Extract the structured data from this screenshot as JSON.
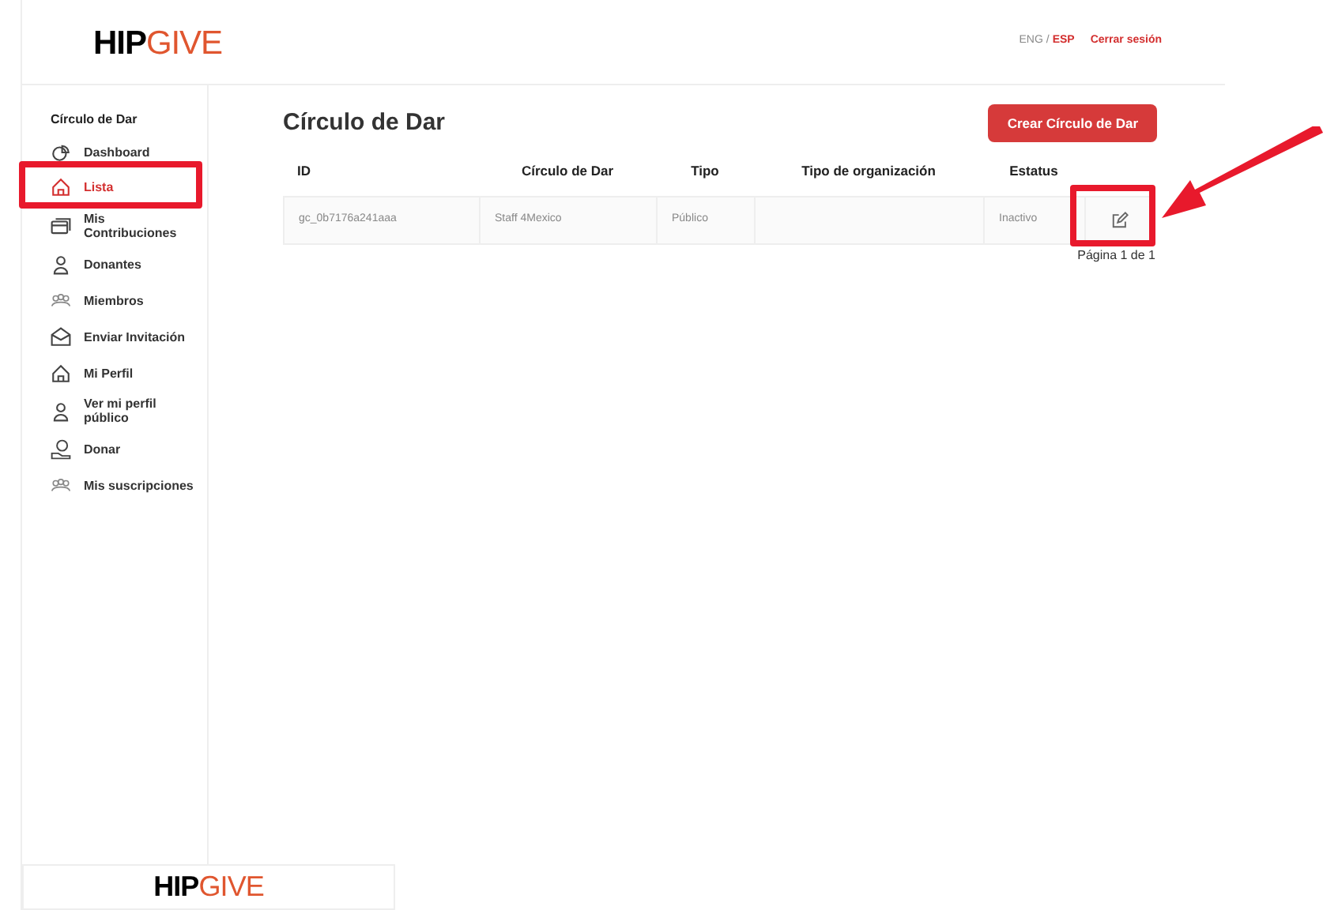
{
  "header": {
    "logo": {
      "bold": "HIP",
      "light": "GIVE"
    },
    "languages": [
      {
        "label": "ENG",
        "selected": false
      },
      {
        "label": "ESP",
        "selected": true
      }
    ],
    "separator": "/",
    "logout": "Cerrar sesión"
  },
  "sidebar": {
    "title": "Círculo de Dar",
    "items": [
      {
        "label": "Dashboard",
        "selected": false
      },
      {
        "label": "Lista",
        "selected": true
      },
      {
        "label": "Mis Contribuciones",
        "selected": false
      },
      {
        "label": "Donantes",
        "selected": false
      },
      {
        "label": "Miembros",
        "selected": false
      },
      {
        "label": "Enviar Invitación",
        "selected": false
      },
      {
        "label": "Mi Perfil",
        "selected": false
      },
      {
        "label": "Ver mi perfil público",
        "selected": false
      },
      {
        "label": "Donar",
        "selected": false
      },
      {
        "label": "Mis suscripciones",
        "selected": false
      }
    ]
  },
  "main": {
    "title": "Círculo de Dar",
    "create_button": "Crear Círculo de Dar",
    "table": {
      "columns": [
        "ID",
        "Círculo de Dar",
        "Tipo",
        "Tipo de organización",
        "Estatus"
      ],
      "rows": [
        {
          "cells": [
            "gc_0b7176a241aaa",
            "Staff 4Mexico",
            "Público",
            "",
            "Inactivo"
          ]
        }
      ]
    },
    "pagination": "Página 1 de 1"
  },
  "footer": {
    "logo": {
      "bold": "HIP",
      "light": "GIVE"
    }
  }
}
